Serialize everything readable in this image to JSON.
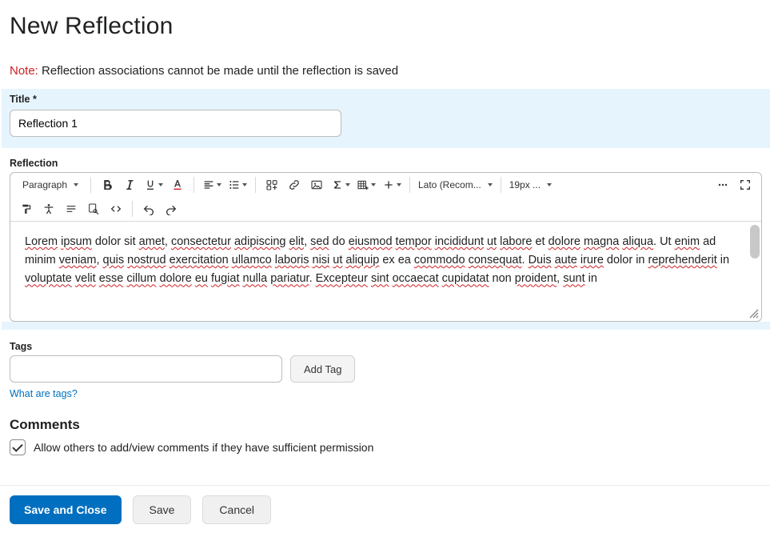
{
  "page": {
    "title": "New Reflection"
  },
  "note": {
    "prefix": "Note:",
    "text": "Reflection associations cannot be made until the reflection is saved"
  },
  "title_field": {
    "label": "Title",
    "required_mark": "*",
    "value": "Reflection 1"
  },
  "reflection": {
    "label": "Reflection"
  },
  "editor": {
    "block_select": "Paragraph",
    "font_select": "Lato (Recom...",
    "size_select": "19px ...",
    "body_tokens": [
      {
        "t": "Lorem",
        "s": true
      },
      {
        "t": " "
      },
      {
        "t": "ipsum",
        "s": true
      },
      {
        "t": " dolor sit "
      },
      {
        "t": "amet",
        "s": true
      },
      {
        "t": ", "
      },
      {
        "t": "consectetur",
        "s": true
      },
      {
        "t": " "
      },
      {
        "t": "adipiscing",
        "s": true
      },
      {
        "t": " "
      },
      {
        "t": "elit",
        "s": true
      },
      {
        "t": ", "
      },
      {
        "t": "sed",
        "s": true
      },
      {
        "t": " do "
      },
      {
        "t": "eiusmod",
        "s": true
      },
      {
        "t": " "
      },
      {
        "t": "tempor",
        "s": true
      },
      {
        "t": " "
      },
      {
        "t": "incididunt",
        "s": true
      },
      {
        "t": " "
      },
      {
        "t": "ut",
        "s": true
      },
      {
        "t": " "
      },
      {
        "t": "labore",
        "s": true
      },
      {
        "t": " et "
      },
      {
        "t": "dolore",
        "s": true
      },
      {
        "t": " "
      },
      {
        "t": "magna",
        "s": true
      },
      {
        "t": " "
      },
      {
        "t": "aliqua",
        "s": true
      },
      {
        "t": ". Ut "
      },
      {
        "t": "enim",
        "s": true
      },
      {
        "t": " ad minim "
      },
      {
        "t": "veniam",
        "s": true
      },
      {
        "t": ", "
      },
      {
        "t": "quis",
        "s": true
      },
      {
        "t": " "
      },
      {
        "t": "nostrud",
        "s": true
      },
      {
        "t": " "
      },
      {
        "t": "exercitation",
        "s": true
      },
      {
        "t": " "
      },
      {
        "t": "ullamco",
        "s": true
      },
      {
        "t": " "
      },
      {
        "t": "laboris",
        "s": true
      },
      {
        "t": " "
      },
      {
        "t": "nisi",
        "s": true
      },
      {
        "t": " "
      },
      {
        "t": "ut",
        "s": true
      },
      {
        "t": " "
      },
      {
        "t": "aliquip",
        "s": true
      },
      {
        "t": " ex ea "
      },
      {
        "t": "commodo",
        "s": true
      },
      {
        "t": " "
      },
      {
        "t": "consequat",
        "s": true
      },
      {
        "t": ". "
      },
      {
        "t": "Duis",
        "s": true
      },
      {
        "t": " "
      },
      {
        "t": "aute",
        "s": true
      },
      {
        "t": " "
      },
      {
        "t": "irure",
        "s": true
      },
      {
        "t": " dolor in "
      },
      {
        "t": "reprehenderit",
        "s": true
      },
      {
        "t": " in "
      },
      {
        "t": "voluptate",
        "s": true
      },
      {
        "t": " "
      },
      {
        "t": "velit",
        "s": true
      },
      {
        "t": " "
      },
      {
        "t": "esse",
        "s": true
      },
      {
        "t": " "
      },
      {
        "t": "cillum",
        "s": true
      },
      {
        "t": " "
      },
      {
        "t": "dolore",
        "s": true
      },
      {
        "t": " "
      },
      {
        "t": "eu",
        "s": true
      },
      {
        "t": " "
      },
      {
        "t": "fugiat",
        "s": true
      },
      {
        "t": " "
      },
      {
        "t": "nulla",
        "s": true
      },
      {
        "t": " "
      },
      {
        "t": "pariatur",
        "s": true
      },
      {
        "t": ". "
      },
      {
        "t": "Excepteur",
        "s": true
      },
      {
        "t": " "
      },
      {
        "t": "sint",
        "s": true
      },
      {
        "t": " "
      },
      {
        "t": "occaecat",
        "s": true
      },
      {
        "t": " "
      },
      {
        "t": "cupidatat",
        "s": true
      },
      {
        "t": " non "
      },
      {
        "t": "proident",
        "s": true
      },
      {
        "t": ", "
      },
      {
        "t": "sunt",
        "s": true
      },
      {
        "t": " in"
      }
    ]
  },
  "tags": {
    "label": "Tags",
    "add_label": "Add Tag",
    "help_link": "What are tags?",
    "value": ""
  },
  "comments": {
    "heading": "Comments",
    "checkbox_label": "Allow others to add/view comments if they have sufficient permission",
    "checked": true
  },
  "footer": {
    "save_close": "Save and Close",
    "save": "Save",
    "cancel": "Cancel"
  }
}
